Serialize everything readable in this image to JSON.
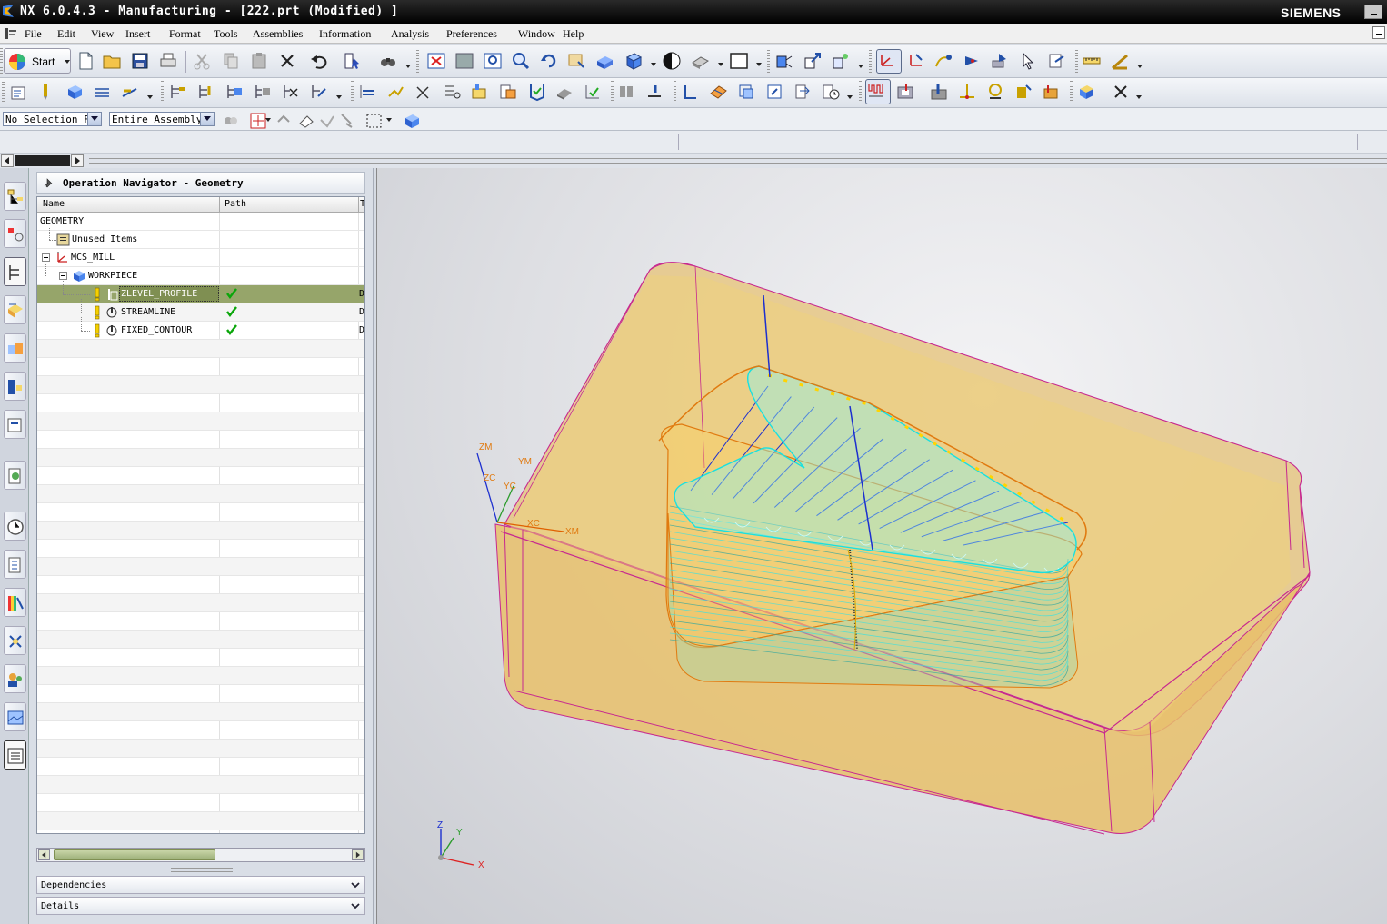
{
  "window": {
    "title": "NX 6.0.4.3 - Manufacturing - [222.prt (Modified) ]",
    "brand": "SIEMENS"
  },
  "menu": [
    "File",
    "Edit",
    "View",
    "Insert",
    "Format",
    "Tools",
    "Assemblies",
    "Information",
    "Analysis",
    "Preferences",
    "Window",
    "Help"
  ],
  "toolbar": {
    "start_label": "Start",
    "selection_filter": "No Selection Fi",
    "scope": "Entire Assembly"
  },
  "navigator": {
    "title": "Operation Navigator - Geometry",
    "columns": [
      "Name",
      "Path",
      "T"
    ],
    "rows": [
      {
        "name": "GEOMETRY",
        "path": "",
        "t": ""
      },
      {
        "name": "Unused Items",
        "path": "",
        "t": ""
      },
      {
        "name": "MCS_MILL",
        "path": "",
        "t": ""
      },
      {
        "name": "WORKPIECE",
        "path": "",
        "t": ""
      },
      {
        "name": "ZLEVEL_PROFILE",
        "path": "ok",
        "t": "D"
      },
      {
        "name": "STREAMLINE",
        "path": "ok",
        "t": "D"
      },
      {
        "name": "FIXED_CONTOUR",
        "path": "ok",
        "t": "D"
      }
    ],
    "selected": "ZLEVEL_PROFILE",
    "panels": [
      "Dependencies",
      "Details"
    ]
  },
  "viewport": {
    "csys_labels": {
      "zm": "ZM",
      "ym": "YM",
      "zc": "ZC",
      "yc": "YC",
      "xc": "XC",
      "xm": "XM"
    },
    "triad_labels": {
      "z": "Z",
      "y": "Y",
      "x": "X"
    }
  },
  "colors": {
    "part_fill": "#e8c06a",
    "part_edge": "#c7288f",
    "toolpath_cyan": "#39e0e0",
    "toolpath_blue": "#1c2fcf",
    "selection_green": "#96a56a"
  }
}
